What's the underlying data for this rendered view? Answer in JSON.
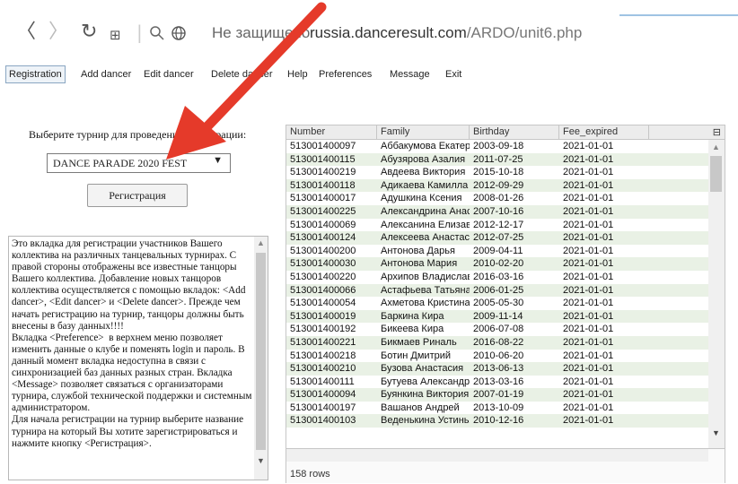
{
  "browser": {
    "back_icon": "back-arrow-icon",
    "forward_icon": "forward-arrow-icon",
    "reload_icon": "reload-icon",
    "apps_icon": "apps-grid-icon",
    "security_text": "Не защищено",
    "url_host": "russia.danceresult.com",
    "url_path": "/ARDO/unit6.php"
  },
  "menu": {
    "items": [
      "Registration",
      "Add dancer",
      "Edit dancer",
      "Delete dancer",
      "Help",
      "Preferences",
      "Message",
      "Exit"
    ],
    "active": "Registration"
  },
  "left": {
    "prompt": "Выберите турнир для проведения регистрации:",
    "tournament_value": "DANCE PARADE 2020 FEST",
    "register_label": "Регистрация",
    "help_text": "Это вкладка для регистрации участников Вашего коллектива на различных танцевальных турнирах. С правой стороны отображены все известные танцоры Вашего коллектива. Добавление новых танцоров коллектива осуществляется с помощью вкладок: <Add dancer>, <Edit dancer> и <Delete dancer>. Прежде чем начать регистрацию на турнир, танцоры должны быть внесены в базу данных!!!!\nВкладка <Preference>  в верхнем меню позволяет изменить данные о клубе и поменять login и пароль. В данный момент вкладка недоступна в связи с синхронизацией баз данных разных стран. Вкладка <Message> позволяет связаться с организаторами турнира, службой технической поддержки и системным администратором.\nДля начала регистрации на турнир выберите название турнира на который Вы хотите зарегистрироваться и нажмите кнопку <Регистрация>."
  },
  "grid": {
    "columns": [
      "Number",
      "Family",
      "Birthday",
      "Fee_expired"
    ],
    "rows": [
      [
        "513001400097",
        "Аббакумова Екатерина",
        "2003-09-18",
        "2021-01-01"
      ],
      [
        "513001400115",
        "Абузярова Азалия",
        "2011-07-25",
        "2021-01-01"
      ],
      [
        "513001400219",
        "Авдеева Виктория",
        "2015-10-18",
        "2021-01-01"
      ],
      [
        "513001400118",
        "Адикаева Камилла",
        "2012-09-29",
        "2021-01-01"
      ],
      [
        "513001400017",
        "Адушкина Ксения",
        "2008-01-26",
        "2021-01-01"
      ],
      [
        "513001400225",
        "Александрина Анастасия",
        "2007-10-16",
        "2021-01-01"
      ],
      [
        "513001400069",
        "Алексанина Елизавета",
        "2012-12-17",
        "2021-01-01"
      ],
      [
        "513001400124",
        "Алексеева Анастасия",
        "2012-07-25",
        "2021-01-01"
      ],
      [
        "513001400200",
        "Антонова Дарья",
        "2009-04-11",
        "2021-01-01"
      ],
      [
        "513001400030",
        "Антонова Мария",
        "2010-02-20",
        "2021-01-01"
      ],
      [
        "513001400220",
        "Архипов Владислав",
        "2016-03-16",
        "2021-01-01"
      ],
      [
        "513001400066",
        "Астафьева Татьяна",
        "2006-01-25",
        "2021-01-01"
      ],
      [
        "513001400054",
        "Ахметова Кристина",
        "2005-05-30",
        "2021-01-01"
      ],
      [
        "513001400019",
        "Баркина Кира",
        "2009-11-14",
        "2021-01-01"
      ],
      [
        "513001400192",
        "Бикеева Кира",
        "2006-07-08",
        "2021-01-01"
      ],
      [
        "513001400221",
        "Бикмаев Риналь",
        "2016-08-22",
        "2021-01-01"
      ],
      [
        "513001400218",
        "Ботин Дмитрий",
        "2010-06-20",
        "2021-01-01"
      ],
      [
        "513001400210",
        "Бузова Анастасия",
        "2013-06-13",
        "2021-01-01"
      ],
      [
        "513001400111",
        "Бутуева Александра",
        "2013-03-16",
        "2021-01-01"
      ],
      [
        "513001400094",
        "Буянкина Виктория",
        "2007-01-19",
        "2021-01-01"
      ],
      [
        "513001400197",
        "Вашанов Андрей",
        "2013-10-09",
        "2021-01-01"
      ],
      [
        "513001400103",
        "Веденькина Устинья",
        "2010-12-16",
        "2021-01-01"
      ]
    ],
    "row_count": "158 rows"
  },
  "colors": {
    "annotation_arrow": "#e53a2a",
    "row_alt": "#e9f1e5",
    "header_bg": "#ececec"
  }
}
